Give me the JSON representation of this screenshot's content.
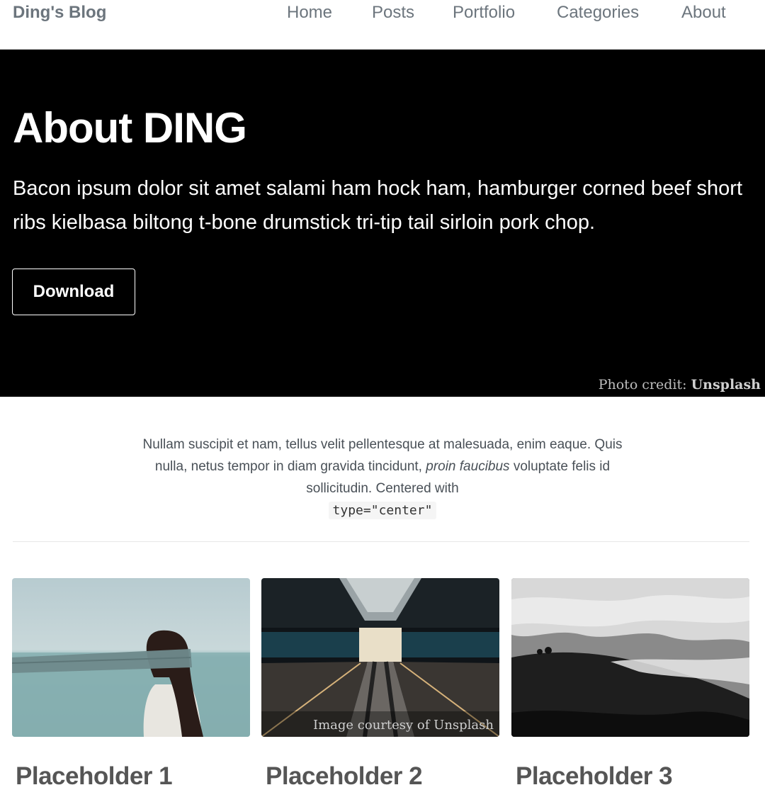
{
  "navbar": {
    "brand": "Ding's Blog",
    "links": [
      "Home",
      "Posts",
      "Portfolio",
      "Categories",
      "About"
    ]
  },
  "hero": {
    "title": "About DING",
    "text": "Bacon ipsum dolor sit amet salami ham hock ham, hamburger corned beef short ribs kielbasa biltong t-bone drumstick tri-tip tail sirloin pork chop.",
    "button_label": "Download",
    "credit_prefix": "Photo credit:",
    "credit_source": "Unsplash"
  },
  "intro": {
    "text_1": "Nullam suscipit et nam, tellus velit pellentesque at malesuada, enim eaque. Quis nulla, netus tempor in diam gravida tincidunt,",
    "text_italic": "proin faucibus",
    "text_2": "voluptate felis id sollicitudin. Centered with",
    "code": "type=\"center\""
  },
  "cards": [
    {
      "title": "Placeholder 1",
      "caption": ""
    },
    {
      "title": "Placeholder 2",
      "caption": "Image courtesy of Unsplash"
    },
    {
      "title": "Placeholder 3",
      "caption": ""
    }
  ]
}
